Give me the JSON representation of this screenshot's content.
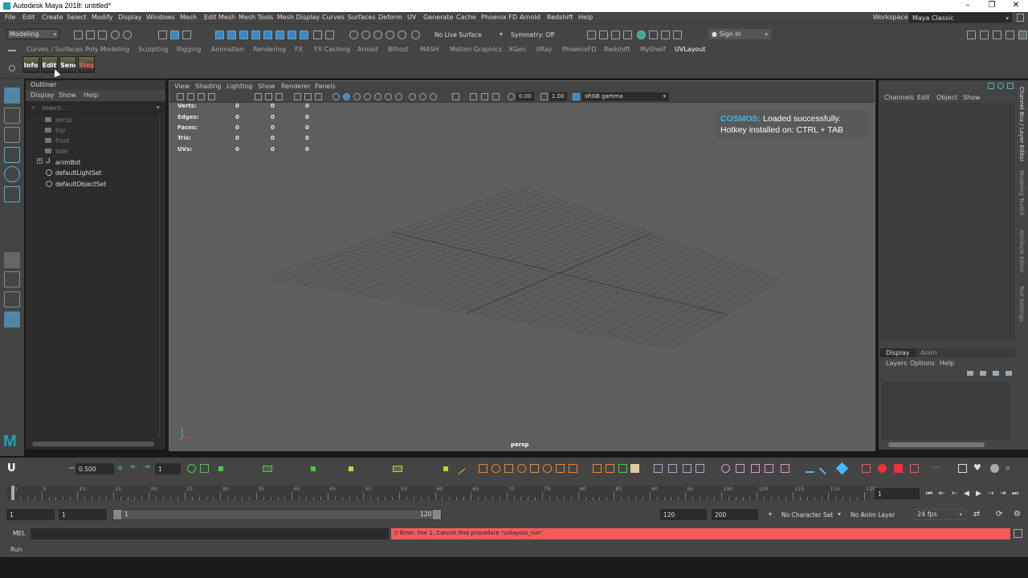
{
  "window": {
    "title": "Autodesk Maya 2018: untitled*",
    "buttons": [
      "minimize",
      "restore",
      "close"
    ]
  },
  "menubar": [
    "File",
    "Edit",
    "Create",
    "Select",
    "Modify",
    "Display",
    "Windows",
    "Mesh",
    "Edit Mesh",
    "Mesh Tools",
    "Mesh Display",
    "Curves",
    "Surfaces",
    "Deform",
    "UV",
    "Generate",
    "Cache",
    "Phoenix FD",
    "Arnold",
    "Redshift",
    "Help"
  ],
  "workspace": {
    "label": "Workspace :",
    "value": "Maya Classic"
  },
  "statusline": {
    "menuset": "Modeling",
    "live_surface": "No Live Surface",
    "symmetry": "Symmetry: Off",
    "sign_in": "Sign In"
  },
  "shelf": {
    "tabs": [
      "Curves / Surfaces",
      "Poly Modeling",
      "Sculpting",
      "Rigging",
      "Animation",
      "Rendering",
      "FX",
      "FX Caching",
      "Arnold",
      "Bifrost",
      "MASH",
      "Motion Graphics",
      "XGen",
      "VRay",
      "PhoenixFD",
      "Redshift",
      "MyShelf",
      "UVLayout"
    ],
    "active_tab": "UVLayout",
    "buttons": [
      "Info",
      "Edit",
      "Send",
      "Stop"
    ]
  },
  "outliner": {
    "title": "Outliner",
    "menu": [
      "Display",
      "Show",
      "Help"
    ],
    "search_placeholder": "Search...",
    "items": [
      {
        "label": "persp",
        "dim": true
      },
      {
        "label": "top",
        "dim": true
      },
      {
        "label": "front",
        "dim": true
      },
      {
        "label": "side",
        "dim": true
      },
      {
        "label": "animBot",
        "dim": false
      },
      {
        "label": "defaultLightSet",
        "dim": false
      },
      {
        "label": "defaultObjectSet",
        "dim": false
      }
    ]
  },
  "viewport": {
    "menu": [
      "View",
      "Shading",
      "Lighting",
      "Show",
      "Renderer",
      "Panels"
    ],
    "exposure": "0.00",
    "gamma": "1.00",
    "color_space": "sRGB gamma",
    "hud": [
      {
        "label": "Verts:",
        "values": [
          "0",
          "0",
          "0"
        ]
      },
      {
        "label": "Edges:",
        "values": [
          "0",
          "0",
          "0"
        ]
      },
      {
        "label": "Faces:",
        "values": [
          "0",
          "0",
          "0"
        ]
      },
      {
        "label": "Tris:",
        "values": [
          "0",
          "0",
          "0"
        ]
      },
      {
        "label": "UVs:",
        "values": [
          "0",
          "0",
          "0"
        ]
      }
    ],
    "cosmos": {
      "name": "COSMOS:",
      "line1": "Loaded successfully.",
      "line2": "Hotkey installed on: CTRL + TAB"
    },
    "camera": "persp"
  },
  "channelbox": {
    "menu": [
      "Channels",
      "Edit",
      "Object",
      "Show"
    ],
    "layer_tabs": [
      "Display",
      "Anim"
    ],
    "layer_menu": [
      "Layers",
      "Options",
      "Help"
    ]
  },
  "side_tabs": [
    "Channel Box / Layer Editor",
    "Modeling Toolkit",
    "Attribute Editor",
    "Tool Settings"
  ],
  "bottom_shelf": {
    "value_field": "0.500",
    "frame_field": "1"
  },
  "timeslider": {
    "ticks": [
      "1",
      "5",
      "10",
      "15",
      "20",
      "25",
      "30",
      "35",
      "40",
      "45",
      "50",
      "55",
      "60",
      "65",
      "70",
      "75",
      "80",
      "85",
      "90",
      "95",
      "100",
      "105",
      "110",
      "115",
      "120"
    ],
    "current_frame": "1"
  },
  "range": {
    "start": "1",
    "playback_start": "1",
    "slider_start": "1",
    "slider_end": "120",
    "playback_end": "120",
    "end": "200",
    "character_set": "No Character Set",
    "anim_layer": "No Anim Layer",
    "fps": "24 fps"
  },
  "cmdline": {
    "label": "MEL",
    "error": "// Error: line 1: Cannot find procedure \"uvlayout_run\".",
    "error_color": "#f25c5c"
  },
  "helpline": "Run"
}
